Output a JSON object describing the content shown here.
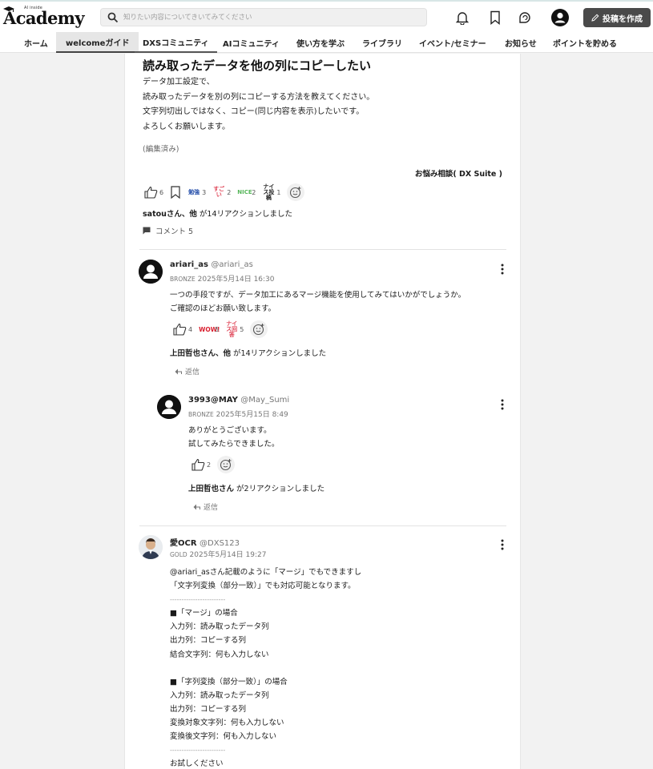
{
  "header": {
    "logo_small": "AI inside",
    "logo_text": "Academy",
    "search_placeholder": "知りたい内容についてきいてみてください",
    "post_button": "投稿を作成"
  },
  "nav": [
    "ホーム",
    "welcomeガイド",
    "DXSコミュニティ",
    "AIコミュニティ",
    "使い方を学ぶ",
    "ライブラリ",
    "イベント/セミナー",
    "お知らせ",
    "ポイントを貯める"
  ],
  "post": {
    "title": "読み取ったデータを他の列にコピーしたい",
    "lines": [
      "データ加工設定で、",
      "読み取ったデータを別の列にコピーする方法を教えてください。",
      "文字列切出しではなく、コピー(同じ内容を表示)したいです。",
      "よろしくお願いします。"
    ],
    "edited": "(編集済み)",
    "category": "お悩み相談( DX Suite )",
    "reactions": [
      {
        "icon": "thumbs-up-icon",
        "count": "6"
      },
      {
        "icon": "stamp-benkyou",
        "label": "勉強",
        "count": "3"
      },
      {
        "icon": "stamp-sugoi",
        "label": "すごい",
        "count": "2"
      },
      {
        "icon": "stamp-nice",
        "label": "NICE",
        "count": "2"
      },
      {
        "icon": "stamp-nice-post",
        "label": "ナイス投稿",
        "count": "1"
      }
    ],
    "reaction_summary_name": "satouさん、他",
    "reaction_summary_text": " が14リアクションしました",
    "comments_label": "コメント 5"
  },
  "comments": [
    {
      "name": "ariari_as",
      "handle": "@ariari_as",
      "rank": "BRONZE",
      "date": "2025年5月14日 16:30",
      "lines": [
        "一つの手段ですが、データ加工にあるマージ機能を使用してみてはいかがでしょうか。",
        "ご確認のほどお願い致します。"
      ],
      "reactions": [
        {
          "icon": "thumbs-up-icon",
          "count": "4"
        },
        {
          "icon": "stamp-wow",
          "label": "WOW!",
          "count": "5"
        },
        {
          "icon": "stamp-nice-kaitou",
          "label": "ナイス回答",
          "count": "5"
        }
      ],
      "reaction_summary_name": "上田哲也さん、他",
      "reaction_summary_text": " が14リアクションしました",
      "reply_label": "返信"
    },
    {
      "name": "3993@MAY",
      "handle": "@May_Sumi",
      "rank": "BRONZE",
      "date": "2025年5月15日 8:49",
      "lines": [
        "ありがとうございます。",
        "試してみたらできました。"
      ],
      "reactions": [
        {
          "icon": "thumbs-up-icon",
          "count": "2"
        }
      ],
      "reaction_summary_name": "上田哲也さん",
      "reaction_summary_text": " が2リアクションしました",
      "reply_label": "返信"
    },
    {
      "name": "愛OCR",
      "handle": "@DXS123",
      "rank": "GOLD",
      "date": "2025年5月14日 19:27",
      "lines": [
        "@ariari_asさん記載のように「マージ」でもできますし",
        "「文字列変換（部分一致）」でも対応可能となります。",
        "------------------------",
        "■「マージ」の場合",
        "入力列：読み取ったデータ列",
        "出力列：コピーする列",
        "結合文字列：何も入力しない",
        "",
        "■「字列変換（部分一致）」の場合",
        "入力列：読み取ったデータ列",
        "出力列：コピーする列",
        "変換対象文字列：何も入力しない",
        "変換後文字列：何も入力しない",
        "------------------------",
        "お試しください"
      ]
    }
  ]
}
